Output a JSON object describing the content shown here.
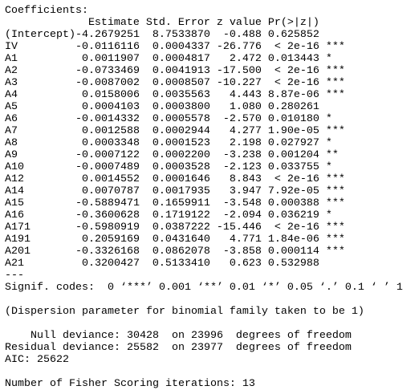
{
  "coefficients": {
    "title": "Coefficients:",
    "headers": {
      "estimate": "Estimate",
      "std_error": "Std. Error",
      "z_value": "z value",
      "p_value": "Pr(>|z|)"
    },
    "rows": [
      {
        "name": "(Intercept)",
        "estimate": "-4.2679251",
        "std_error": "8.7533870",
        "z_value": "-0.488",
        "p_value": "0.625852",
        "signif": ""
      },
      {
        "name": "IV",
        "estimate": "-0.0116116",
        "std_error": "0.0004337",
        "z_value": "-26.776",
        "p_value": "< 2e-16",
        "signif": "***"
      },
      {
        "name": "A1",
        "estimate": "0.0011907",
        "std_error": "0.0004817",
        "z_value": "2.472",
        "p_value": "0.013443",
        "signif": "*"
      },
      {
        "name": "A2",
        "estimate": "-0.0733469",
        "std_error": "0.0041913",
        "z_value": "-17.500",
        "p_value": "< 2e-16",
        "signif": "***"
      },
      {
        "name": "A3",
        "estimate": "-0.0087002",
        "std_error": "0.0008507",
        "z_value": "-10.227",
        "p_value": "< 2e-16",
        "signif": "***"
      },
      {
        "name": "A4",
        "estimate": "0.0158006",
        "std_error": "0.0035563",
        "z_value": "4.443",
        "p_value": "8.87e-06",
        "signif": "***"
      },
      {
        "name": "A5",
        "estimate": "0.0004103",
        "std_error": "0.0003800",
        "z_value": "1.080",
        "p_value": "0.280261",
        "signif": ""
      },
      {
        "name": "A6",
        "estimate": "-0.0014332",
        "std_error": "0.0005578",
        "z_value": "-2.570",
        "p_value": "0.010180",
        "signif": "*"
      },
      {
        "name": "A7",
        "estimate": "0.0012588",
        "std_error": "0.0002944",
        "z_value": "4.277",
        "p_value": "1.90e-05",
        "signif": "***"
      },
      {
        "name": "A8",
        "estimate": "0.0003348",
        "std_error": "0.0001523",
        "z_value": "2.198",
        "p_value": "0.027927",
        "signif": "*"
      },
      {
        "name": "A9",
        "estimate": "-0.0007122",
        "std_error": "0.0002200",
        "z_value": "-3.238",
        "p_value": "0.001204",
        "signif": "**"
      },
      {
        "name": "A10",
        "estimate": "-0.0007489",
        "std_error": "0.0003528",
        "z_value": "-2.123",
        "p_value": "0.033755",
        "signif": "*"
      },
      {
        "name": "A12",
        "estimate": "0.0014552",
        "std_error": "0.0001646",
        "z_value": "8.843",
        "p_value": "< 2e-16",
        "signif": "***"
      },
      {
        "name": "A14",
        "estimate": "0.0070787",
        "std_error": "0.0017935",
        "z_value": "3.947",
        "p_value": "7.92e-05",
        "signif": "***"
      },
      {
        "name": "A15",
        "estimate": "-0.5889471",
        "std_error": "0.1659911",
        "z_value": "-3.548",
        "p_value": "0.000388",
        "signif": "***"
      },
      {
        "name": "A16",
        "estimate": "-0.3600628",
        "std_error": "0.1719122",
        "z_value": "-2.094",
        "p_value": "0.036219",
        "signif": "*"
      },
      {
        "name": "A171",
        "estimate": "-0.5980919",
        "std_error": "0.0387222",
        "z_value": "-15.446",
        "p_value": "< 2e-16",
        "signif": "***"
      },
      {
        "name": "A191",
        "estimate": "0.2059169",
        "std_error": "0.0431640",
        "z_value": "4.771",
        "p_value": "1.84e-06",
        "signif": "***"
      },
      {
        "name": "A201",
        "estimate": "-0.3326168",
        "std_error": "0.0862078",
        "z_value": "-3.858",
        "p_value": "0.000114",
        "signif": "***"
      },
      {
        "name": "A21",
        "estimate": "0.3200427",
        "std_error": "0.5133410",
        "z_value": "0.623",
        "p_value": "0.532988",
        "signif": ""
      }
    ],
    "separator": "---",
    "signif_codes": "Signif. codes:  0 ‘***’ 0.001 ‘**’ 0.01 ‘*’ 0.05 ‘.’ 0.1 ‘ ’ 1"
  },
  "dispersion": "(Dispersion parameter for binomial family taken to be 1)",
  "null_deviance": "    Null deviance: 30428  on 23996  degrees of freedom",
  "residual_deviance": "Residual deviance: 25582  on 23977  degrees of freedom",
  "aic": "AIC: 25622",
  "fisher_iterations": "Number of Fisher Scoring iterations: 13"
}
